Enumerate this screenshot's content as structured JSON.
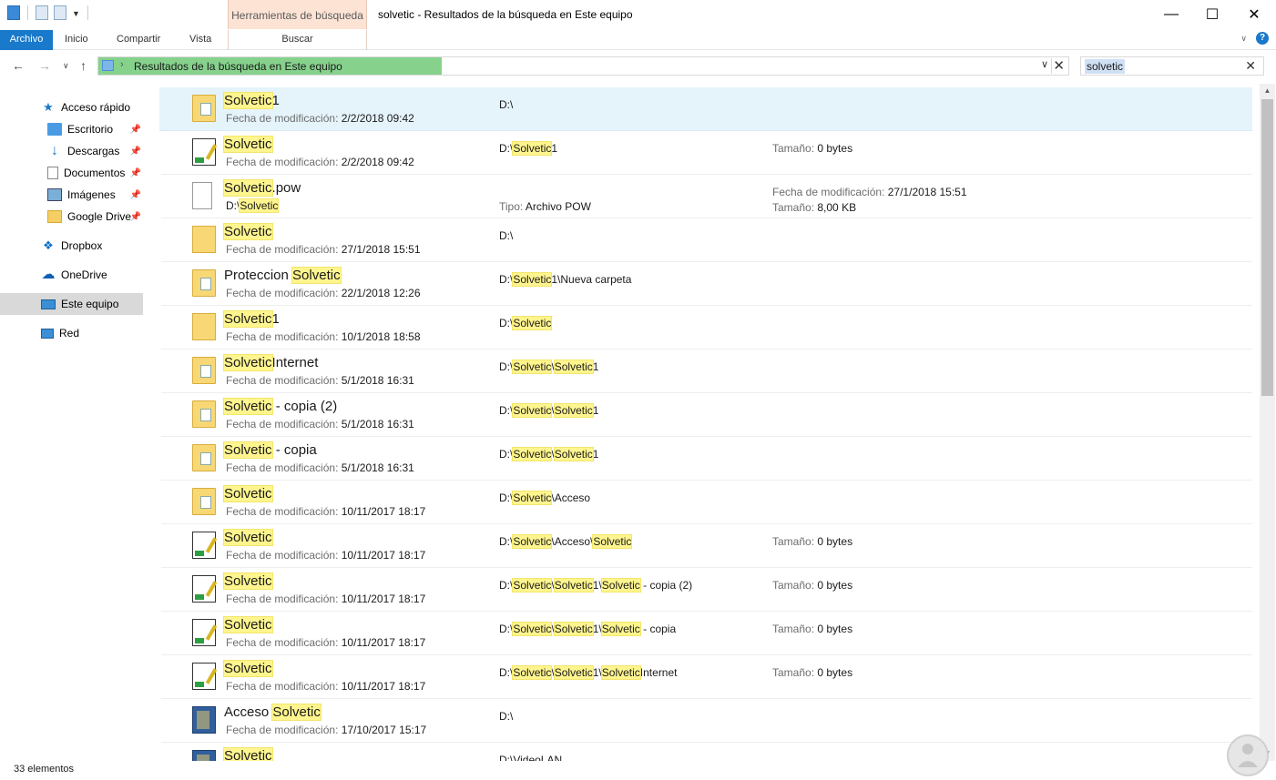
{
  "window": {
    "title": "solvetic - Resultados de la búsqueda en Este equipo",
    "contextual_tab": "Herramientas de búsqueda",
    "minimize": "—",
    "maximize": "☐",
    "close": "✕"
  },
  "ribbon": {
    "file": "Archivo",
    "home": "Inicio",
    "share": "Compartir",
    "view": "Vista",
    "search": "Buscar"
  },
  "address": {
    "path": "Resultados de la búsqueda en Este equipo"
  },
  "search": {
    "value": "solvetic"
  },
  "sidebar": {
    "items": [
      {
        "label": "Acceso rápido",
        "icon": "star-icon"
      },
      {
        "label": "Escritorio",
        "icon": "desktop-icon",
        "pinned": true
      },
      {
        "label": "Descargas",
        "icon": "download-icon",
        "pinned": true
      },
      {
        "label": "Documentos",
        "icon": "document-icon",
        "pinned": true
      },
      {
        "label": "Imágenes",
        "icon": "images-icon",
        "pinned": true
      },
      {
        "label": "Google Drive",
        "icon": "folder-icon",
        "pinned": true
      },
      {
        "label": "Dropbox",
        "icon": "dropbox-icon"
      },
      {
        "label": "OneDrive",
        "icon": "onedrive-icon"
      },
      {
        "label": "Este equipo",
        "icon": "computer-icon",
        "selected": true
      },
      {
        "label": "Red",
        "icon": "network-icon"
      }
    ]
  },
  "labels": {
    "modified": "Fecha de modificación:",
    "size": "Tamaño:",
    "type": "Tipo:"
  },
  "results": [
    {
      "name_hl": "Solvetic",
      "name_rest": "1",
      "date": "2/2/2018 09:42",
      "path": "D:\\",
      "icon": "folder-image-icon",
      "selected": true
    },
    {
      "name_hl": "Solvetic",
      "name_rest": "",
      "date": "2/2/2018 09:42",
      "path_parts": [
        "D:\\",
        "Solvetic",
        "1"
      ],
      "size": "0 bytes",
      "icon": "notepadpp-icon"
    },
    {
      "name_hl": "Solvetic",
      "name_rest": ".pow",
      "path_parts": [
        "D:\\",
        "Solvetic"
      ],
      "type": "Archivo POW",
      "mod_right": "27/1/2018 15:51",
      "size": "8,00 KB",
      "icon": "blank-file-icon"
    },
    {
      "name_hl": "Solvetic",
      "name_rest": "",
      "date": "27/1/2018 15:51",
      "path": "D:\\",
      "icon": "empty-folder-icon"
    },
    {
      "name_pre": "Proteccion ",
      "name_hl": "Solvetic",
      "name_rest": "",
      "date": "22/1/2018 12:26",
      "path_parts": [
        "D:\\",
        "Solvetic",
        "1\\Nueva carpeta"
      ],
      "icon": "folder-image-icon"
    },
    {
      "name_hl": "Solvetic",
      "name_rest": "1",
      "date": "10/1/2018 18:58",
      "path_parts": [
        "D:\\",
        "Solvetic",
        ""
      ],
      "icon": "folder-doc-icon"
    },
    {
      "name_hl": "Solvetic",
      "name_rest": "Internet",
      "date": "5/1/2018 16:31",
      "path_parts": [
        "D:\\",
        "Solvetic",
        "\\",
        "Solvetic",
        "1"
      ],
      "icon": "folder-image-icon"
    },
    {
      "name_hl": "Solvetic",
      "name_rest": " - copia (2)",
      "date": "5/1/2018 16:31",
      "path_parts": [
        "D:\\",
        "Solvetic",
        "\\",
        "Solvetic",
        "1"
      ],
      "icon": "folder-image-icon"
    },
    {
      "name_hl": "Solvetic",
      "name_rest": " - copia",
      "date": "5/1/2018 16:31",
      "path_parts": [
        "D:\\",
        "Solvetic",
        "\\",
        "Solvetic",
        "1"
      ],
      "icon": "folder-image-icon"
    },
    {
      "name_hl": "Solvetic",
      "name_rest": "",
      "date": "10/11/2017 18:17",
      "path_parts": [
        "D:\\",
        "Solvetic",
        "\\Acceso"
      ],
      "icon": "folder-image-icon"
    },
    {
      "name_hl": "Solvetic",
      "name_rest": "",
      "date": "10/11/2017 18:17",
      "path_parts": [
        "D:\\",
        "Solvetic",
        "\\Acceso\\",
        "Solvetic",
        ""
      ],
      "size": "0 bytes",
      "icon": "notepadpp-icon"
    },
    {
      "name_hl": "Solvetic",
      "name_rest": "",
      "date": "10/11/2017 18:17",
      "path_parts": [
        "D:\\",
        "Solvetic",
        "\\",
        "Solvetic",
        "1\\",
        "Solvetic",
        " - copia (2)"
      ],
      "size": "0 bytes",
      "icon": "notepadpp-icon"
    },
    {
      "name_hl": "Solvetic",
      "name_rest": "",
      "date": "10/11/2017 18:17",
      "path_parts": [
        "D:\\",
        "Solvetic",
        "\\",
        "Solvetic",
        "1\\",
        "Solvetic",
        " - copia"
      ],
      "size": "0 bytes",
      "icon": "notepadpp-icon"
    },
    {
      "name_hl": "Solvetic",
      "name_rest": "",
      "date": "10/11/2017 18:17",
      "path_parts": [
        "D:\\",
        "Solvetic",
        "\\",
        "Solvetic",
        "1\\",
        "Solvetic",
        "Internet"
      ],
      "size": "0 bytes",
      "icon": "notepadpp-icon"
    },
    {
      "name_pre": "Acceso ",
      "name_hl": "Solvetic",
      "name_rest": "",
      "date": "17/10/2017 15:17",
      "path": "D:\\",
      "icon": "access-db-icon"
    },
    {
      "name_hl": "Solvetic",
      "name_rest": "",
      "path": "D:\\VideoLAN",
      "icon": "access-db-icon",
      "partial": true
    }
  ],
  "status": {
    "count": "33 elementos"
  }
}
